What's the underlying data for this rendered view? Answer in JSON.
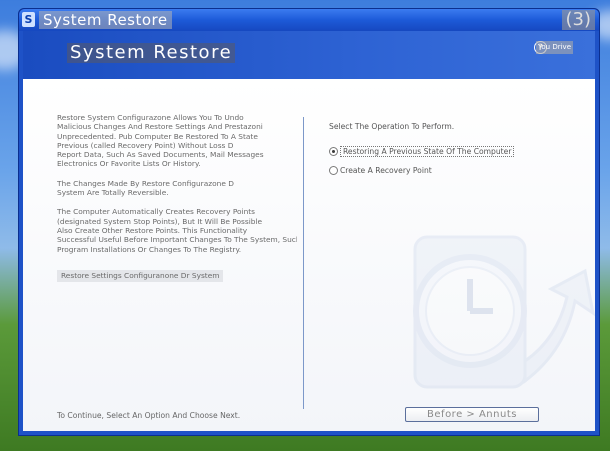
{
  "window": {
    "title": "System Restore",
    "title_badge": "(3)"
  },
  "header": {
    "title": "System Restore",
    "help_label": "You Drive"
  },
  "left_panel": {
    "paragraphs": [
      {
        "lines": [
          "Restore System Configurazone Allows You To Undo",
          "Malicious Changes And Restore Settings And Prestazoni",
          "Unprecedented. Pub Computer Be Restored To A State",
          "Previous (called Recovery Point) Without Loss D",
          "Report Data, Such As Saved Documents, Mail Messages",
          "Electronics Or Favorite Lists Or History."
        ]
      },
      {
        "lines": [
          "The Changes Made By Restore Configurazone D",
          "System Are Totally Reversible."
        ]
      },
      {
        "lines": [
          "The Computer Automatically Creates Recovery Points",
          "(designated System Stop Points), But It Will Be Possible",
          "Also Create Other Restore Points. This Functionality",
          "Successful Useful Before Important Changes To The System, Such As",
          "Program Installations Or Changes To The Registry."
        ]
      }
    ],
    "restore_link": "Restore Settings Configuranone Dr System"
  },
  "right_panel": {
    "operation_title": "Select The Operation To Perform.",
    "options": [
      {
        "label": "Restoring A Previous State Of The Computer",
        "checked": true
      },
      {
        "label": "Create A Recovery Point",
        "checked": false
      }
    ]
  },
  "footer": {
    "instruction": "To Continue, Select An Option And Choose Next.",
    "next_button": "Before > Annuts"
  },
  "colors": {
    "title_bar": "#1d5ad8",
    "header_band": "#2e63d4",
    "content_bg": "#ffffff",
    "divider": "#7c98c9"
  }
}
